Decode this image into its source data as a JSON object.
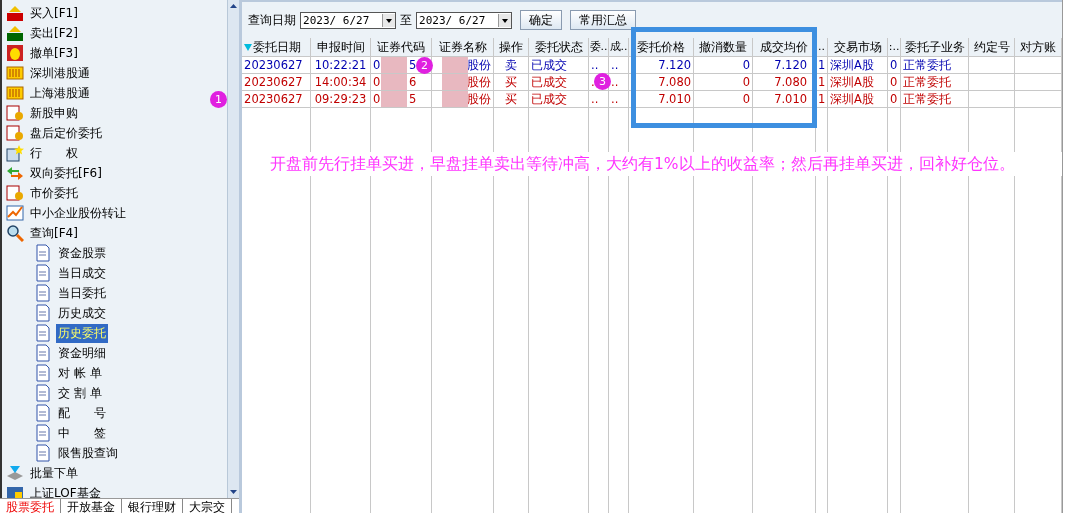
{
  "sidebar": {
    "items": [
      {
        "label": "买入[F1]",
        "kind": "buy",
        "selected": false
      },
      {
        "label": "卖出[F2]",
        "kind": "sell",
        "selected": false
      },
      {
        "label": "撤单[F3]",
        "kind": "hand",
        "selected": false
      },
      {
        "label": "深圳港股通",
        "kind": "hk",
        "selected": false
      },
      {
        "label": "上海港股通",
        "kind": "hk",
        "selected": false
      },
      {
        "label": "新股申购",
        "kind": "coins",
        "selected": false
      },
      {
        "label": "盘后定价委托",
        "kind": "coins",
        "selected": false
      },
      {
        "label": "行　　权",
        "kind": "star",
        "selected": false
      },
      {
        "label": "双向委托[F6]",
        "kind": "arrows",
        "selected": false
      },
      {
        "label": "市价委托",
        "kind": "coins",
        "selected": false
      },
      {
        "label": "中小企业股份转让",
        "kind": "chart",
        "selected": false
      },
      {
        "label": "查询[F4]",
        "kind": "search",
        "selected": false,
        "children": [
          {
            "label": "资金股票",
            "selected": false
          },
          {
            "label": "当日成交",
            "selected": false
          },
          {
            "label": "当日委托",
            "selected": false
          },
          {
            "label": "历史成交",
            "selected": false
          },
          {
            "label": "历史委托",
            "selected": true
          },
          {
            "label": "资金明细",
            "selected": false
          },
          {
            "label": "对 帐 单",
            "selected": false
          },
          {
            "label": "交 割 单",
            "selected": false
          },
          {
            "label": "配　　号",
            "selected": false
          },
          {
            "label": "中　　签",
            "selected": false
          },
          {
            "label": "限售股查询",
            "selected": false
          }
        ]
      },
      {
        "label": "批量下单",
        "kind": "stack",
        "selected": false
      },
      {
        "label": "上证LOF基金",
        "kind": "fund",
        "selected": false
      }
    ]
  },
  "bottom_tabs": [
    {
      "label": "股票委托",
      "selected": true
    },
    {
      "label": "开放基金",
      "selected": false
    },
    {
      "label": "银行理财",
      "selected": false
    },
    {
      "label": "大宗交",
      "selected": false
    }
  ],
  "toolbar": {
    "date_label": "查询日期",
    "date_from": "2023/ 6/27",
    "to_label": "至",
    "date_to": "2023/ 6/27",
    "buttons": [
      "确定",
      "常用汇总"
    ]
  },
  "table": {
    "columns": [
      "委托日期",
      "申报时间",
      "证券代码",
      "证券名称",
      "操作",
      "委托状态",
      "委..",
      "成..",
      "委托价格",
      "撤消数量",
      "成交均价",
      "..",
      "交易市场",
      ":..",
      "委托子业务",
      "约定号",
      "对方账"
    ],
    "rows": [
      {
        "color": "#0000b0",
        "code_end": "5",
        "cells": [
          "20230627",
          "10:22:21",
          "0",
          "股份",
          "卖",
          "已成交",
          "..",
          "..",
          "7.120",
          "0",
          "7.120",
          "1",
          "深圳A股",
          "0",
          "正常委托",
          "",
          ""
        ]
      },
      {
        "color": "#c00000",
        "code_end": "6",
        "cells": [
          "20230627",
          "14:00:34",
          "0",
          "股份",
          "买",
          "已成交",
          "..",
          "..",
          "7.080",
          "0",
          "7.080",
          "1",
          "深圳A股",
          "0",
          "正常委托",
          "",
          ""
        ]
      },
      {
        "color": "#c00000",
        "code_end": "5",
        "cells": [
          "20230627",
          "09:29:23",
          "0",
          "股份",
          "买",
          "已成交",
          "..",
          "..",
          "7.010",
          "0",
          "7.010",
          "1",
          "深圳A股",
          "0",
          "正常委托",
          "",
          ""
        ]
      }
    ]
  },
  "annotations": {
    "markers": [
      "1",
      "2",
      "3"
    ],
    "note": "开盘前先行挂单买进，早盘挂单卖出等待冲高，大约有1%以上的收益率；然后再挂单买进，回补好仓位。"
  }
}
